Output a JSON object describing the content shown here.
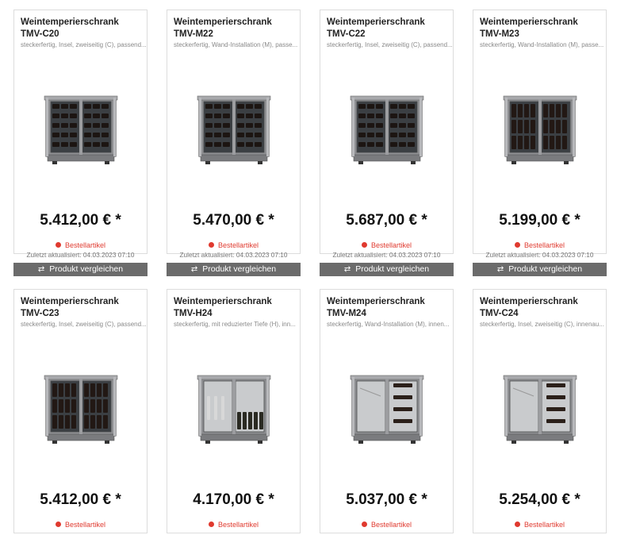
{
  "products": [
    {
      "name": "Weintemperierschrank",
      "model": "TMV-C20",
      "desc": "steckerfertig, Insel, zweiseitig (C), passend...",
      "price": "5.412,00 € *",
      "status": "Bestellartikel",
      "updated": "Zuletzt aktualisiert: 04.03.2023 07:10",
      "compare": "Produkt vergleichen",
      "variant": "wine-dense"
    },
    {
      "name": "Weintemperierschrank",
      "model": "TMV-M22",
      "desc": "steckerfertig, Wand-Installation (M), passe...",
      "price": "5.470,00 € *",
      "status": "Bestellartikel",
      "updated": "Zuletzt aktualisiert: 04.03.2023 07:10",
      "compare": "Produkt vergleichen",
      "variant": "wine-slant"
    },
    {
      "name": "Weintemperierschrank",
      "model": "TMV-C22",
      "desc": "steckerfertig, Insel, zweiseitig (C), passend...",
      "price": "5.687,00 € *",
      "status": "Bestellartikel",
      "updated": "Zuletzt aktualisiert: 04.03.2023 07:10",
      "compare": "Produkt vergleichen",
      "variant": "wine-slant"
    },
    {
      "name": "Weintemperierschrank",
      "model": "TMV-M23",
      "desc": "steckerfertig, Wand-Installation (M), passe...",
      "price": "5.199,00 € *",
      "status": "Bestellartikel",
      "updated": "Zuletzt aktualisiert: 04.03.2023 07:10",
      "compare": "Produkt vergleichen",
      "variant": "wine-upright"
    },
    {
      "name": "Weintemperierschrank",
      "model": "TMV-C23",
      "desc": "steckerfertig, Insel, zweiseitig (C), passend...",
      "price": "5.412,00 € *",
      "status": "Bestellartikel",
      "updated": "",
      "compare": "",
      "variant": "wine-upright"
    },
    {
      "name": "Weintemperierschrank",
      "model": "TMV-H24",
      "desc": "steckerfertig, mit reduzierter Tiefe (H), inn...",
      "price": "4.170,00 € *",
      "status": "Bestellartikel",
      "updated": "",
      "compare": "",
      "variant": "champagne"
    },
    {
      "name": "Weintemperierschrank",
      "model": "TMV-M24",
      "desc": "steckerfertig, Wand-Installation (M), innen...",
      "price": "5.037,00 € *",
      "status": "Bestellartikel",
      "updated": "",
      "compare": "",
      "variant": "sparse"
    },
    {
      "name": "Weintemperierschrank",
      "model": "TMV-C24",
      "desc": "steckerfertig, Insel, zweiseitig (C), innenau...",
      "price": "5.254,00 € *",
      "status": "Bestellartikel",
      "updated": "",
      "compare": "",
      "variant": "sparse"
    }
  ],
  "icons": {
    "status": "red-dot-icon",
    "compare": "compare-arrows-icon"
  },
  "colors": {
    "status": "#e03a2f",
    "compare_bg": "#6b6b6b"
  }
}
